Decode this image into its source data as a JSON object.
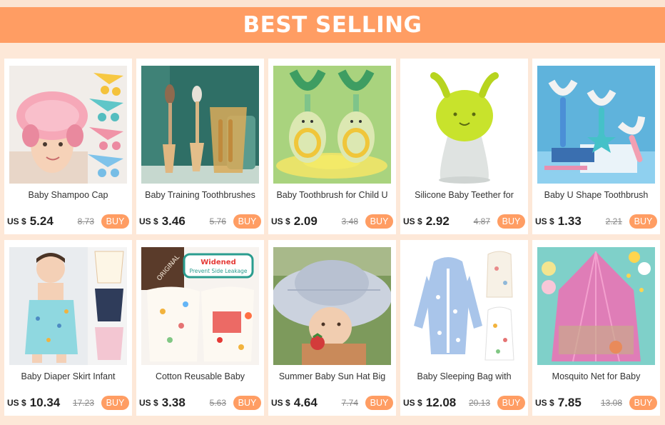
{
  "banner": {
    "title": "BEST SELLING"
  },
  "colors": {
    "accent": "#ff9d63",
    "background": "#fde8d8"
  },
  "currency_label": "US $",
  "buy_label": "BUY",
  "products": [
    {
      "title": "Baby Shampoo Cap",
      "price": "5.24",
      "old_price": "8.73",
      "image": "shampoo-cap-photo"
    },
    {
      "title": "Baby Training Toothbrushes",
      "price": "3.46",
      "old_price": "5.76",
      "image": "training-toothbrush-photo"
    },
    {
      "title": "Baby Toothbrush for Child U",
      "price": "2.09",
      "old_price": "3.48",
      "image": "u-toothbrush-avocado-photo"
    },
    {
      "title": "Silicone Baby Teether for",
      "price": "2.92",
      "old_price": "4.87",
      "image": "silicone-teether-photo"
    },
    {
      "title": "Baby U Shape Toothbrush",
      "price": "1.33",
      "old_price": "2.21",
      "image": "u-shape-toothbrush-photo"
    },
    {
      "title": "Baby Diaper Skirt Infant",
      "price": "10.34",
      "old_price": "17.23",
      "image": "diaper-skirt-photo"
    },
    {
      "title": "Cotton Reusable Baby",
      "price": "3.38",
      "old_price": "5.63",
      "image": "reusable-diaper-photo",
      "badge_line1": "Widened",
      "badge_line2": "Prevent Side Leakage",
      "badge_side": "ORIGINAL"
    },
    {
      "title": "Summer Baby Sun Hat Big",
      "price": "4.64",
      "old_price": "7.74",
      "image": "sun-hat-photo"
    },
    {
      "title": "Baby Sleeping Bag with",
      "price": "12.08",
      "old_price": "20.13",
      "image": "sleeping-bag-photo"
    },
    {
      "title": "Mosquito Net for Baby",
      "price": "7.85",
      "old_price": "13.08",
      "image": "mosquito-net-photo"
    }
  ]
}
